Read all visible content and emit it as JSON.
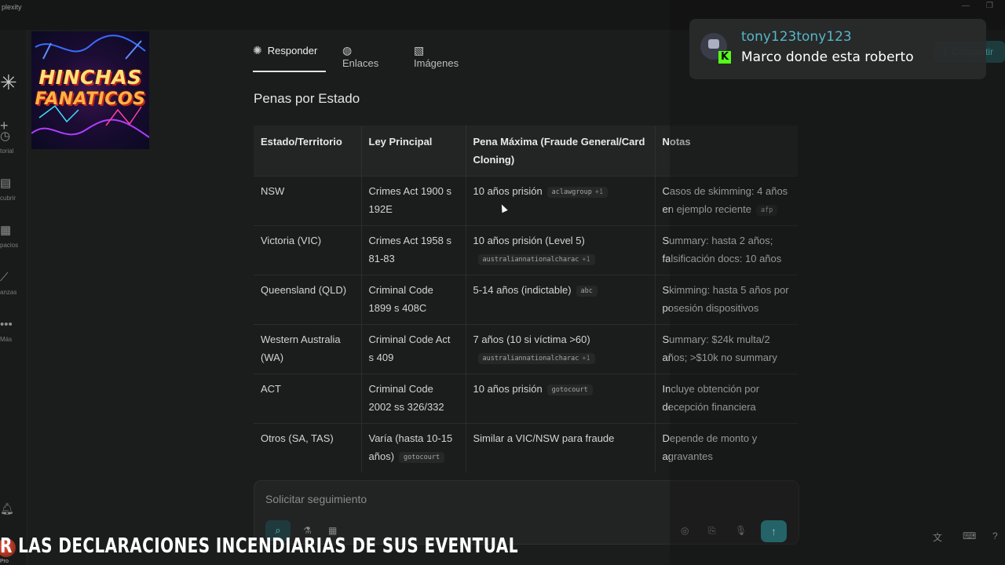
{
  "app": {
    "title": "plexity"
  },
  "sidebar": {
    "items": [
      {
        "icon": "history-icon",
        "glyph": "◷",
        "label": "torial"
      },
      {
        "icon": "discover-icon",
        "glyph": "▤",
        "label": "cubrir"
      },
      {
        "icon": "spaces-icon",
        "glyph": "▦",
        "label": "pacios"
      },
      {
        "icon": "finance-icon",
        "glyph": "⟋",
        "label": "anzas"
      },
      {
        "icon": "more-icon",
        "glyph": "•••",
        "label": "Más"
      }
    ],
    "pro_label": "Pro"
  },
  "thumbnail": {
    "line1": "HINCHAS",
    "line2": "FANATICOS"
  },
  "tabs": [
    {
      "icon": "answer-icon",
      "glyph": "✺",
      "label": "Responder"
    },
    {
      "icon": "globe-icon",
      "glyph": "◍",
      "label": "Enlaces"
    },
    {
      "icon": "image-icon",
      "glyph": "▧",
      "label": "Imágenes"
    }
  ],
  "section": {
    "title": "Penas por Estado"
  },
  "table": {
    "headers": [
      "Estado/Territorio",
      "Ley Principal",
      "Pena Máxima (Fraude General/Card Cloning)",
      "Notas"
    ],
    "rows": [
      {
        "estado": "NSW",
        "ley": "Crimes Act 1900 s 192E",
        "ley_cite": "",
        "pena": "10 años prisión",
        "pena_cite": "aclawgroup",
        "pena_cite_more": "+1",
        "notas": "Casos de skimming: 4 años en ejemplo reciente",
        "notas_cite": "afp"
      },
      {
        "estado": "Victoria (VIC)",
        "ley": "Crimes Act 1958 s 81-83",
        "ley_cite": "",
        "pena": "10 años prisión (Level 5)",
        "pena_cite": "australiannationalcharac",
        "pena_cite_more": "+1",
        "notas": "Summary: hasta 2 años; falsificación docs: 10 años",
        "notas_cite": ""
      },
      {
        "estado": "Queensland (QLD)",
        "ley": "Criminal Code 1899 s 408C",
        "ley_cite": "",
        "pena": "5-14 años (indictable)",
        "pena_cite": "abc",
        "pena_cite_more": "",
        "notas": "Skimming: hasta 5 años por posesión dispositivos",
        "notas_cite": ""
      },
      {
        "estado": "Western Australia (WA)",
        "ley": "Criminal Code Act s 409",
        "ley_cite": "",
        "pena": "7 años (10 si víctima >60)",
        "pena_cite": "australiannationalcharac",
        "pena_cite_more": "+1",
        "notas": "Summary: $24k multa/2 años; >$10k no summary",
        "notas_cite": ""
      },
      {
        "estado": "ACT",
        "ley": "Criminal Code 2002 ss 326/332",
        "ley_cite": "",
        "pena": "10 años prisión",
        "pena_cite": "gotocourt",
        "pena_cite_more": "",
        "notas": "Incluye obtención por decepción financiera",
        "notas_cite": ""
      },
      {
        "estado": "Otros (SA, TAS)",
        "ley": "Varía (hasta 10-15 años)",
        "ley_cite": "gotocourt",
        "pena": "Similar a VIC/NSW para fraude",
        "pena_cite": "",
        "pena_cite_more": "",
        "notas": "Depende de monto y agravantes",
        "notas_cite": ""
      }
    ]
  },
  "composer": {
    "placeholder": "Solicitar seguimiento"
  },
  "header": {
    "share_label": "Compartir"
  },
  "notification": {
    "username": "tony123tony123",
    "message": "Marco donde esta roberto"
  },
  "ticker": {
    "text": "R LAS DECLARACIONES INCENDIARIAS DE SUS EVENTUALES PANELISTAS, A LA SA"
  },
  "colors": {
    "accent": "#2e8b91",
    "username": "#56b6c9",
    "kick": "#53fc18"
  }
}
